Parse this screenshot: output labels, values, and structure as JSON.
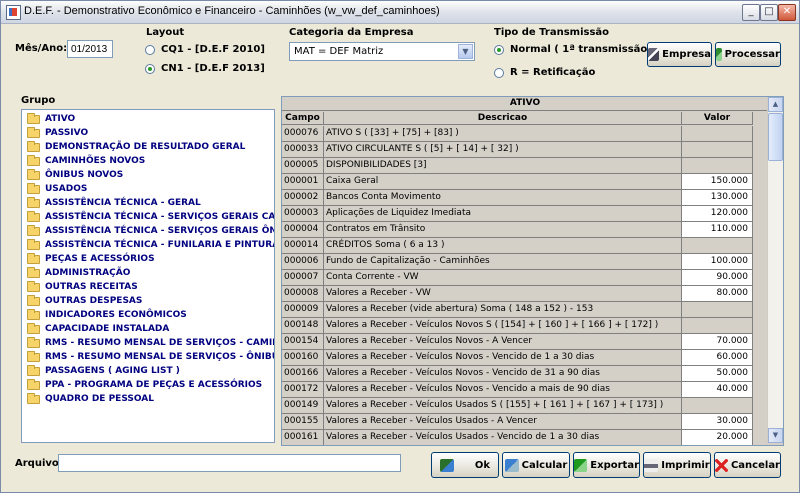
{
  "window": {
    "title": "D.E.F. - Demonstrativo Econômico e Financeiro - Caminhões (w_vw_def_caminhoes)"
  },
  "controls": {
    "minimize": "_",
    "maximize": "□",
    "close": "✕"
  },
  "period": {
    "label": "Mês/Ano:",
    "value": "01/2013"
  },
  "layout": {
    "label": "Layout",
    "options": [
      "CQ1 - [D.E.F 2010]",
      "CN1 - [D.E.F 2013]"
    ],
    "selected_index": 1
  },
  "category": {
    "label": "Categoria da Empresa",
    "value": "MAT = DEF Matriz"
  },
  "transmission": {
    "label": "Tipo de Transmissão",
    "normal": "Normal ( 1ª transmissão)",
    "retificacao": "R = Retificação",
    "selected": "normal"
  },
  "buttons": {
    "empresa": "Empresa",
    "processar": "Processar",
    "ok": "Ok",
    "calcular": "Calcular",
    "exportar": "Exportar",
    "imprimir": "Imprimir",
    "cancelar": "Cancelar"
  },
  "group": {
    "label": "Grupo",
    "items": [
      "ATIVO",
      "PASSIVO",
      "DEMONSTRAÇÃO DE RESULTADO GERAL",
      "CAMINHÕES NOVOS",
      "ÔNIBUS NOVOS",
      "USADOS",
      "ASSISTÊNCIA TÉCNICA - GERAL",
      "ASSISTÊNCIA TÉCNICA - SERVIÇOS GERAIS CAMIN",
      "ASSISTÊNCIA TÉCNICA - SERVIÇOS GERAIS ÔNIBU",
      "ASSISTÊNCIA TÉCNICA - FUNILARIA E PINTURA GE",
      "PEÇAS E ACESSÓRIOS",
      "ADMINISTRAÇÃO",
      "OUTRAS RECEITAS",
      "OUTRAS DESPESAS",
      "INDICADORES ECONÔMICOS",
      "CAPACIDADE INSTALADA",
      "RMS - RESUMO MENSAL DE SERVIÇOS - CAMINHÕI",
      "RMS - RESUMO MENSAL DE SERVIÇOS - ÔNIBUS",
      "PASSAGENS ( AGING LIST )",
      "PPA - PROGRAMA DE PEÇAS E ACESSÓRIOS",
      "QUADRO DE PESSOAL"
    ]
  },
  "table": {
    "title": "ATIVO",
    "columns": [
      "Campo",
      "Descricao",
      "Valor"
    ],
    "rows": [
      {
        "campo": "000076",
        "descricao": "ATIVO S ( [33] + [75] + [83] )",
        "valor": ""
      },
      {
        "campo": "000033",
        "descricao": "ATIVO CIRCULANTE S ( [5] + [ 14] + [ 32] )",
        "valor": ""
      },
      {
        "campo": "000005",
        "descricao": "DISPONIBILIDADES [3]",
        "valor": ""
      },
      {
        "campo": "000001",
        "descricao": "Caixa Geral",
        "valor": "150.000"
      },
      {
        "campo": "000002",
        "descricao": "Bancos Conta Movimento",
        "valor": "130.000"
      },
      {
        "campo": "000003",
        "descricao": "Aplicações de Liquidez Imediata",
        "valor": "120.000"
      },
      {
        "campo": "000004",
        "descricao": "Contratos em Trânsito",
        "valor": "110.000"
      },
      {
        "campo": "000014",
        "descricao": "CRÉDITOS Soma ( 6 a 13 )",
        "valor": ""
      },
      {
        "campo": "000006",
        "descricao": "Fundo de Capitalização - Caminhões",
        "valor": "100.000"
      },
      {
        "campo": "000007",
        "descricao": "Conta Corrente - VW",
        "valor": "90.000"
      },
      {
        "campo": "000008",
        "descricao": "Valores a Receber - VW",
        "valor": "80.000"
      },
      {
        "campo": "000009",
        "descricao": "Valores a Receber (vide abertura) Soma ( 148 a 152 ) - 153",
        "valor": ""
      },
      {
        "campo": "000148",
        "descricao": "Valores a Receber - Veículos Novos S ( [154] + [ 160 ] + [ 166 ] + [ 172] )",
        "valor": ""
      },
      {
        "campo": "000154",
        "descricao": "Valores a Receber - Veículos Novos - A Vencer",
        "valor": "70.000"
      },
      {
        "campo": "000160",
        "descricao": "Valores a Receber - Veículos Novos - Vencido de 1 a 30 dias",
        "valor": "60.000"
      },
      {
        "campo": "000166",
        "descricao": "Valores a Receber - Veículos Novos - Vencido de 31 a 90 dias",
        "valor": "50.000"
      },
      {
        "campo": "000172",
        "descricao": "Valores a Receber - Veículos Novos - Vencido a mais de 90 dias",
        "valor": "40.000"
      },
      {
        "campo": "000149",
        "descricao": "Valores a Receber - Veículos Usados S ( [155] + [ 161 ] + [ 167 ] + [ 173] )",
        "valor": ""
      },
      {
        "campo": "000155",
        "descricao": "Valores a Receber - Veículos Usados - A Vencer",
        "valor": "30.000"
      },
      {
        "campo": "000161",
        "descricao": "Valores a Receber - Veículos Usados - Vencido de 1 a 30 dias",
        "valor": "20.000"
      }
    ]
  },
  "arquivo": {
    "label": "Arquivo:",
    "value": ""
  },
  "colors": {
    "tree_text": "#000080",
    "window_bg": "#ece9d8",
    "grid_bg": "#d4d0c8"
  }
}
